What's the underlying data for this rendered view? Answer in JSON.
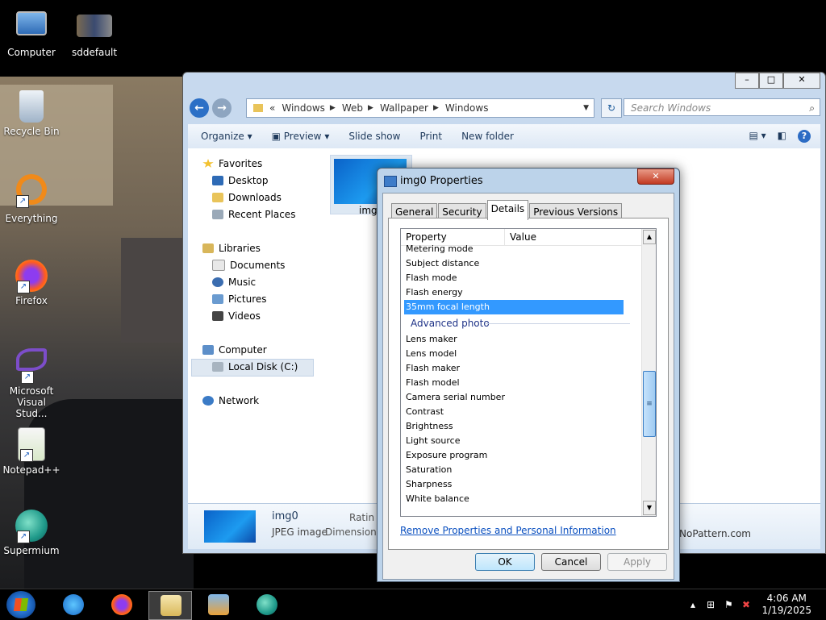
{
  "desktop": {
    "icons": [
      {
        "label": "Computer"
      },
      {
        "label": "sddefault"
      },
      {
        "label": "Recycle Bin"
      },
      {
        "label": "Everything"
      },
      {
        "label": "Firefox"
      },
      {
        "label": "Microsoft Visual Stud..."
      },
      {
        "label": "Notepad++"
      },
      {
        "label": "Supermium"
      }
    ]
  },
  "explorer": {
    "breadcrumb_prefix": "«",
    "breadcrumb": [
      "Windows",
      "Web",
      "Wallpaper",
      "Windows"
    ],
    "search_placeholder": "Search Windows",
    "toolbar": {
      "organize": "Organize",
      "preview": "Preview",
      "slideshow": "Slide show",
      "print": "Print",
      "new_folder": "New folder"
    },
    "nav": {
      "favorites": "Favorites",
      "desktop": "Desktop",
      "downloads": "Downloads",
      "recent": "Recent Places",
      "libraries": "Libraries",
      "documents": "Documents",
      "music": "Music",
      "pictures": "Pictures",
      "videos": "Videos",
      "computer": "Computer",
      "local_disk": "Local Disk (C:)",
      "network": "Network"
    },
    "file_label": "img",
    "details": {
      "name": "img0",
      "type": "JPEG image",
      "rating_label": "Ratin",
      "dimensions_label": "Dimensions",
      "copyright_fragment": "f NoPattern.com"
    }
  },
  "dialog": {
    "title": "img0 Properties",
    "tabs": [
      "General",
      "Security",
      "Details",
      "Previous Versions"
    ],
    "active_tab": "Details",
    "columns": {
      "property": "Property",
      "value": "Value"
    },
    "rows_top": [
      "Metering mode",
      "Subject distance",
      "Flash mode",
      "Flash energy"
    ],
    "selected_row": "35mm focal length",
    "group_label": "Advanced photo",
    "rows_bottom": [
      "Lens maker",
      "Lens model",
      "Flash maker",
      "Flash model",
      "Camera serial number",
      "Contrast",
      "Brightness",
      "Light source",
      "Exposure program",
      "Saturation",
      "Sharpness",
      "White balance"
    ],
    "remove_link": "Remove Properties and Personal Information",
    "buttons": {
      "ok": "OK",
      "cancel": "Cancel",
      "apply": "Apply"
    }
  },
  "taskbar": {
    "time": "4:06 AM",
    "date": "1/19/2025"
  },
  "colors": {
    "selection": "#3399ff",
    "link": "#0b50c0",
    "group_header": "#1e3287"
  }
}
